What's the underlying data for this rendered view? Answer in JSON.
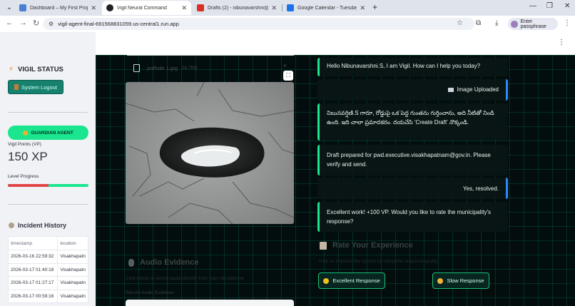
{
  "browser": {
    "tabs": [
      {
        "title": "Dashboard – My First Project –",
        "favicon_color": "#4a7fd4",
        "active": false
      },
      {
        "title": "Vigil Neural Command",
        "favicon_color": "#202124",
        "active": true
      },
      {
        "title": "Drafts (2) - nibunavarshni@gm",
        "favicon_color": "#d93025",
        "active": false
      },
      {
        "title": "Google Calendar - Tuesday, M",
        "favicon_color": "#1a73e8",
        "active": false
      }
    ],
    "url": "vigil-agent-final-691568831059.us-central1.run.app",
    "passphrase_label": "Enter passphrase"
  },
  "sidebar": {
    "status_title": "VIGIL STATUS",
    "logout_label": "System Logout",
    "agent_badge": "GUARDIAN AGENT",
    "vp_label": "Vigil Points (VP)",
    "vp_value": "150 XP",
    "level_label": "Level Progress",
    "level_progress": 0.5,
    "history_title": "Incident History",
    "history_columns": [
      "timestamp",
      "location"
    ],
    "history_rows": [
      [
        "2026-03-16 22:59:32",
        "Visakhapatn"
      ],
      [
        "2026-03-17 01:40:18",
        "Visakhapatn"
      ],
      [
        "2026-03-17 01:27:17",
        "Visakhapatn"
      ],
      [
        "2026-03-17 00:59:16",
        "Visakhapatn"
      ]
    ]
  },
  "upload": {
    "file_name": "pothole 1.jpg",
    "file_size": "16.7KB"
  },
  "audio": {
    "title": "Audio Evidence",
    "subtitle": "Click below to record audio directly from your microphone.",
    "record_label": "Record Audio Evidence"
  },
  "chat": [
    {
      "role": "assistant",
      "text": "Hello Nibunavarshni.S, I am Vigil. How can I help you today?"
    },
    {
      "role": "user",
      "text": "Image Uploaded",
      "icon": "image-icon"
    },
    {
      "role": "assistant",
      "text": "నిబునవర్షిణి.S గారూ, రోడ్డుపై ఒక పెద్ద గుంతను గుర్తించాను, అది నీటితో నిండి ఉంది. ఇది చాలా ప్రమాదకరం. దయచేసి 'Create Draft' నొక్కండి."
    },
    {
      "role": "assistant",
      "text": "Draft prepared for pwd.executive.visakhapatnam@gov.in. Please verify and send."
    },
    {
      "role": "user",
      "text": "Yes, resolved."
    },
    {
      "role": "assistant",
      "text": "Excellent work! +100 VP. Would you like to rate the municipality's response?"
    }
  ],
  "rating": {
    "title": "Rate Your Experience",
    "subtitle": "Help us improve the system by rating the response quality.",
    "excellent_label": "Excellent Response",
    "slow_label": "Slow Response"
  },
  "colors": {
    "accent_green": "#19e68e",
    "logout_bg": "#16826e",
    "progress_red": "#e04646",
    "user_border": "#2a8cff"
  }
}
